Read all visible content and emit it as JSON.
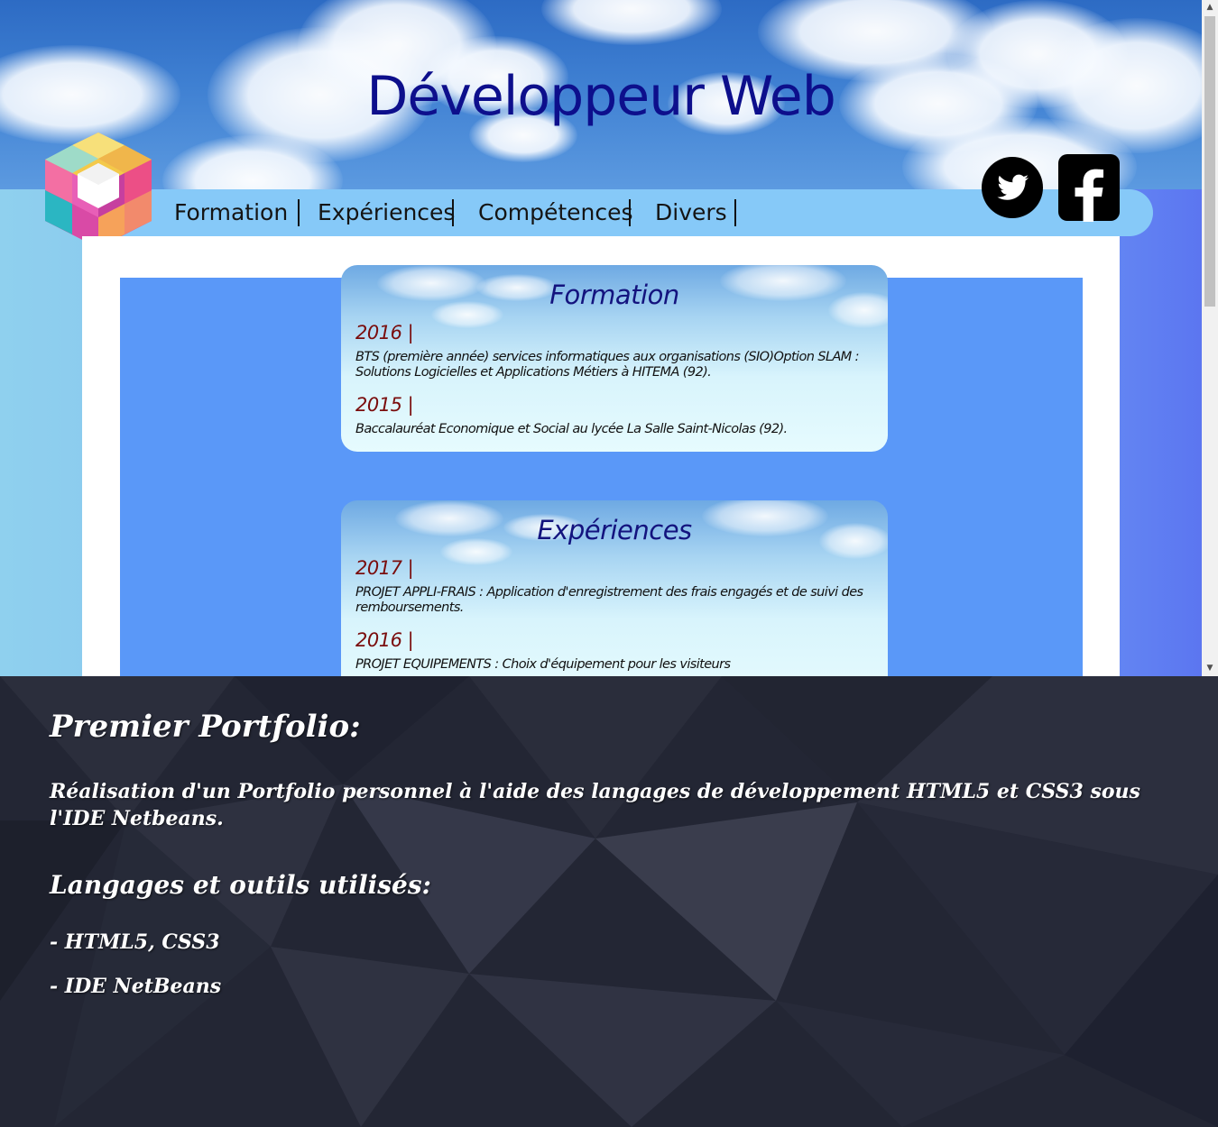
{
  "header": {
    "site_title": "Développeur Web"
  },
  "nav": {
    "items": [
      {
        "label": "Formation"
      },
      {
        "label": "Expériences"
      },
      {
        "label": "Compétences"
      },
      {
        "label": "Divers"
      }
    ]
  },
  "social": {
    "twitter_icon": "twitter-bird-icon",
    "facebook_icon": "facebook-f-icon"
  },
  "cards": {
    "formation": {
      "title": "Formation",
      "entries": [
        {
          "year": "2016 |",
          "text": "BTS (première année) services informatiques aux organisations (SIO)Option SLAM : Solutions Logicielles et Applications Métiers à HITEMA (92)."
        },
        {
          "year": "2015 |",
          "text": "Baccalauréat Economique et Social au lycée La Salle Saint-Nicolas (92)."
        }
      ]
    },
    "experiences": {
      "title": "Expériences",
      "entries": [
        {
          "year": "2017 |",
          "text": "PROJET APPLI-FRAIS : Application d'enregistrement des frais engagés et de suivi des remboursements."
        },
        {
          "year": "2016 |",
          "text": "PROJET EQUIPEMENTS : Choix d'équipement pour les visiteurs"
        }
      ]
    }
  },
  "project": {
    "heading": "Premier Portfolio:",
    "description": "Réalisation d'un Portfolio personnel à l'aide des langages de développement HTML5 et CSS3 sous l'IDE Netbeans.",
    "tools_heading": "Langages et outils utilisés:",
    "tools": [
      "- HTML5, CSS3",
      "- IDE NetBeans"
    ]
  },
  "colors": {
    "title": "#0d0f8c",
    "navbar": "#86c9f8",
    "main_blue": "#5a98f8",
    "year": "#7a0d0d",
    "card_title": "#13137e",
    "panel_dark": "#232634"
  }
}
